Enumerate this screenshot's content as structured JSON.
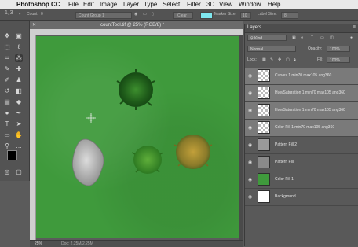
{
  "menubar": {
    "app": "Photoshop CC",
    "items": [
      "File",
      "Edit",
      "Image",
      "Layer",
      "Type",
      "Select",
      "Filter",
      "3D",
      "View",
      "Window",
      "Help"
    ]
  },
  "options": {
    "count_label": "Count:",
    "count_value": "0",
    "group_value": "Count Group 1",
    "clear_label": "Clear",
    "color_swatch": "#7fe8f0",
    "marker_size_label": "Marker Size:",
    "marker_size_value": "10",
    "label_size_label": "Label Size:",
    "label_size_value": "8"
  },
  "document": {
    "title": "countTool.tif @ 25% (RGB/8) *",
    "zoom": "25%",
    "info": "Doc: 2.25M/2.25M"
  },
  "colors": {
    "grass": "#3f9a3c",
    "foreground": "#000000",
    "background": "#ffffff"
  },
  "layers_panel": {
    "tab": "Layers",
    "filter_kind": "Kind",
    "blend_mode": "Normal",
    "opacity_label": "Opacity:",
    "opacity_value": "100%",
    "lock_label": "Lock:",
    "fill_label": "Fill:",
    "fill_value": "100%",
    "layers": [
      {
        "name": "Curves 1 min70 max105 ang360",
        "selected": true,
        "thumb": "adjust"
      },
      {
        "name": "Hue/Saturation 1 min70 max105 ang360",
        "selected": true,
        "thumb": "adjust"
      },
      {
        "name": "Hue/Saturation 1 min70 max105 ang360",
        "selected": true,
        "thumb": "adjust"
      },
      {
        "name": "Color Fill 1 min70 max105 ang360",
        "selected": true,
        "thumb": "adjust"
      },
      {
        "name": "Pattern Fill 2",
        "selected": false,
        "thumb": "pattern"
      },
      {
        "name": "Pattern Fill",
        "selected": false,
        "thumb": "pattern"
      },
      {
        "name": "Color Fill 1",
        "selected": false,
        "thumb": "green"
      },
      {
        "name": "Background",
        "selected": false,
        "thumb": "white"
      }
    ]
  }
}
